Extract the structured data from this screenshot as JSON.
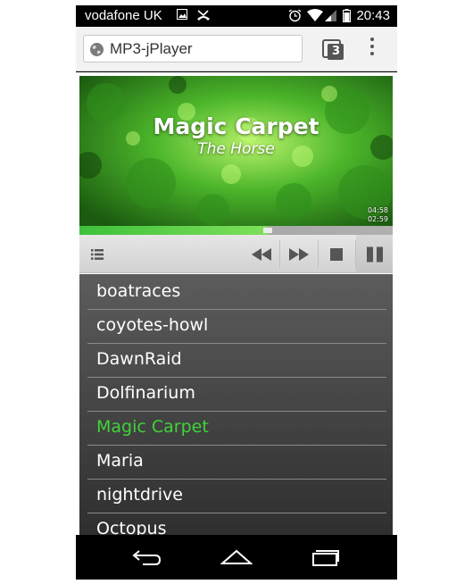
{
  "status_bar": {
    "carrier": "vodafone UK",
    "time": "20:43"
  },
  "browser": {
    "url": "MP3-jPlayer",
    "tab_count": "3"
  },
  "player": {
    "title": "Magic Carpet",
    "artist": "The Horse",
    "total_time": "04:58",
    "current_time": "02:59",
    "progress_fraction": 0.6,
    "accent_color": "#3ed33a"
  },
  "controls": {
    "icons": [
      "playlist-icon",
      "rewind-icon",
      "fast-forward-icon",
      "stop-icon",
      "pause-icon"
    ]
  },
  "playlist": [
    "boatraces",
    "coyotes-howl",
    "DawnRaid",
    "Dolfinarium",
    "Magic Carpet",
    "Maria",
    "nightdrive",
    "Octopus"
  ],
  "active_track_index": 4
}
